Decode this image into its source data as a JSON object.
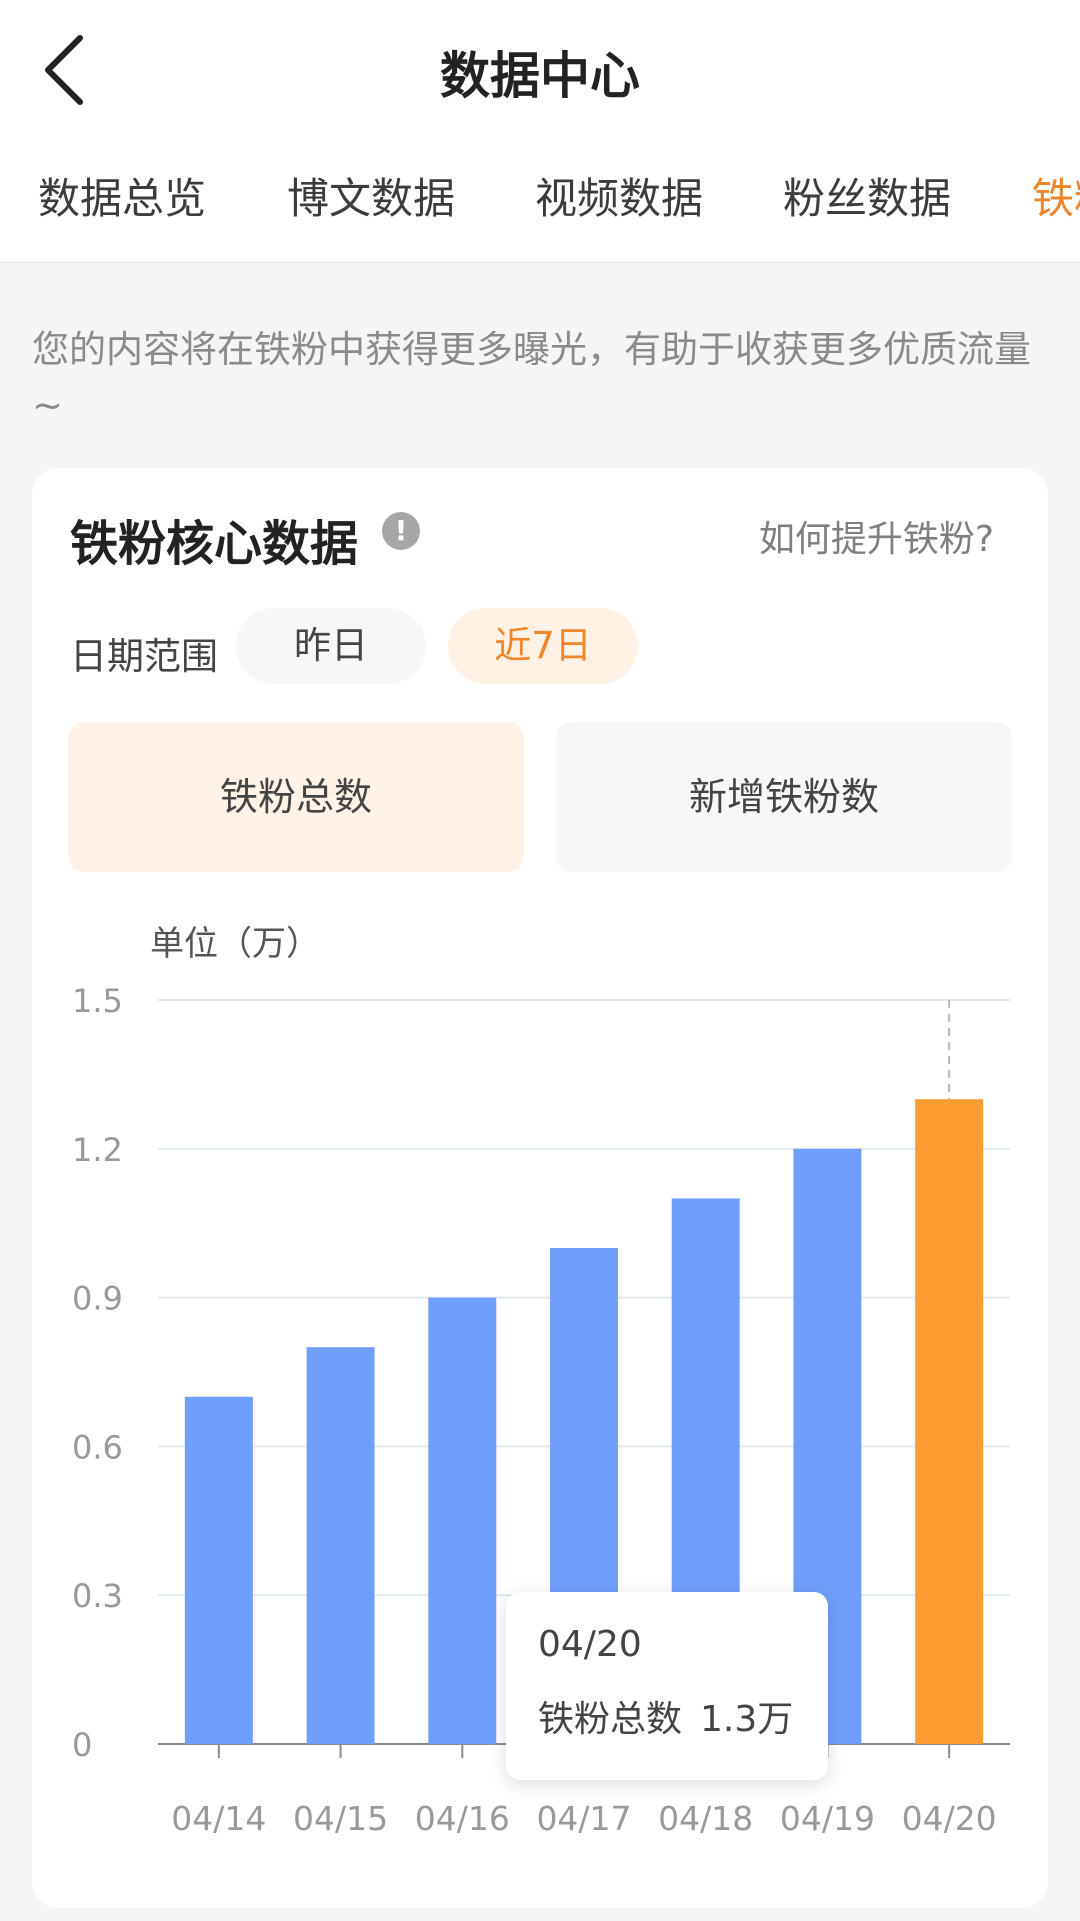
{
  "header": {
    "title": "数据中心"
  },
  "tabs": [
    {
      "label": "数据总览"
    },
    {
      "label": "博文数据"
    },
    {
      "label": "视频数据"
    },
    {
      "label": "粉丝数据"
    },
    {
      "label": "铁粉数据",
      "active": true
    }
  ],
  "hint": "您的内容将在铁粉中获得更多曝光，有助于收获更多优质流量~",
  "card": {
    "title": "铁粉核心数据",
    "how_link": "如何提升铁粉?",
    "date_label": "日期范围",
    "date_options": [
      "昨日",
      "近7日"
    ],
    "selected_date": "近7日",
    "metrics": [
      "铁粉总数",
      "新增铁粉数"
    ],
    "selected_metric": "铁粉总数",
    "unit": "单位（万）"
  },
  "tooltip": {
    "date": "04/20",
    "label": "铁粉总数",
    "value": "1.3万"
  },
  "colors": {
    "accent": "#f0862a",
    "bar": "#6e9ffa",
    "bar_highlight": "#ff9c33"
  },
  "chart_data": {
    "type": "bar",
    "categories": [
      "04/14",
      "04/15",
      "04/16",
      "04/17",
      "04/18",
      "04/19",
      "04/20"
    ],
    "series": [
      {
        "name": "铁粉总数",
        "values": [
          0.7,
          0.8,
          0.9,
          1.0,
          1.1,
          1.2,
          1.3
        ]
      }
    ],
    "yticks": [
      "0",
      "0.3",
      "0.6",
      "0.9",
      "1.2",
      "1.5"
    ],
    "ylim": [
      0,
      1.5
    ],
    "ylabel": "单位（万）",
    "highlight_category": "04/20",
    "grid": true
  }
}
